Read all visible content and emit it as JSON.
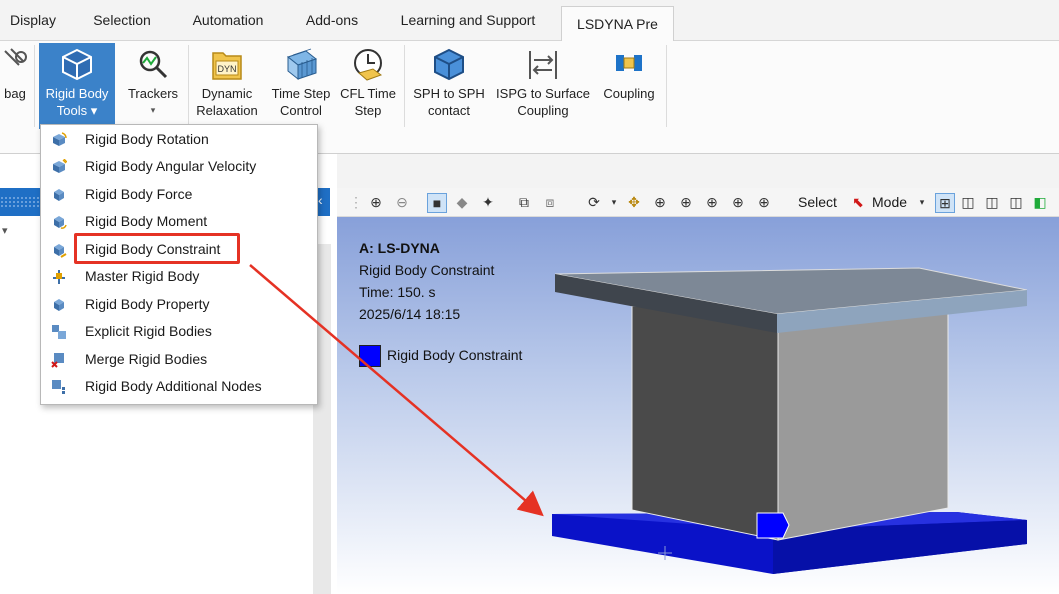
{
  "tabs": [
    {
      "label": "Display"
    },
    {
      "label": "Selection"
    },
    {
      "label": "Automation"
    },
    {
      "label": "Add-ons"
    },
    {
      "label": "Learning and Support"
    },
    {
      "label": "LSDYNA Pre"
    }
  ],
  "ribbon": {
    "airbag_label": "bag",
    "rigid_body_tools": {
      "line1": "Rigid Body",
      "line2": "Tools ▾"
    },
    "trackers": {
      "line1": "Trackers",
      "line2": "▾"
    },
    "dynamic_relaxation": {
      "line1": "Dynamic",
      "line2": "Relaxation",
      "icon_text": "DYN"
    },
    "time_step_control": {
      "line1": "Time Step",
      "line2": "Control"
    },
    "cfl_time_step": {
      "line1": "CFL Time",
      "line2": "Step"
    },
    "sph_to_sph": {
      "line1": "SPH to SPH",
      "line2": "contact"
    },
    "ispg": {
      "line1": "ISPG to Surface",
      "line2": "Coupling"
    },
    "coupling": {
      "line1": "Coupling"
    }
  },
  "menu": {
    "items": [
      {
        "label": "Rigid Body Rotation"
      },
      {
        "label": "Rigid Body Angular Velocity"
      },
      {
        "label": "Rigid Body Force"
      },
      {
        "label": "Rigid Body Moment"
      },
      {
        "label": "Rigid Body Constraint"
      },
      {
        "label": "Master Rigid Body"
      },
      {
        "label": "Rigid Body Property"
      },
      {
        "label": "Explicit Rigid Bodies"
      },
      {
        "label": "Merge Rigid Bodies"
      },
      {
        "label": "Rigid Body Additional Nodes"
      }
    ],
    "highlighted": "Rigid Body Constraint"
  },
  "view_toolbar": {
    "select_label": "Select",
    "mode_label": "Mode"
  },
  "viewport": {
    "title": "A: LS-DYNA",
    "object": "Rigid Body Constraint",
    "time": "Time: 150. s",
    "date": "2025/6/14 18:15",
    "legend_label": "Rigid Body Constraint",
    "legend_color": "#0000ff"
  },
  "colors": {
    "accent": "#1f6fc5",
    "highlight_box": "#e53224",
    "constraint_blue": "#0a12c8"
  }
}
